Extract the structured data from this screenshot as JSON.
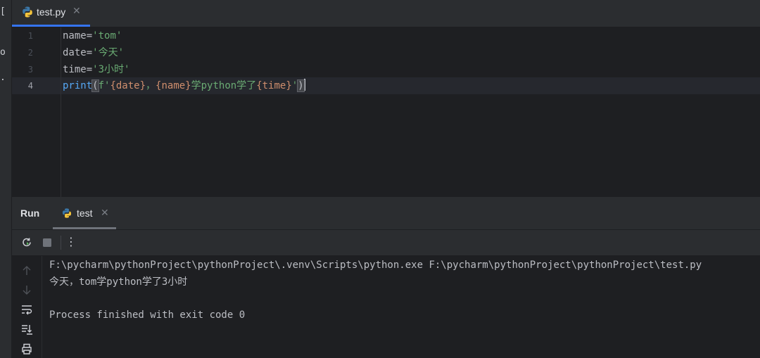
{
  "editor": {
    "tab": {
      "label": "test.py",
      "close": "✕"
    },
    "line_numbers": [
      "1",
      "2",
      "3",
      "4"
    ],
    "code": {
      "line1": {
        "var": "name",
        "eq": "=",
        "str": "'tom'"
      },
      "line2": {
        "var": "date",
        "eq": "=",
        "str": "'今天'"
      },
      "line3": {
        "var": "time",
        "eq": "=",
        "str": "'3小时'"
      },
      "line4": {
        "fn": "print",
        "open": "(",
        "prefix": "f'",
        "b1": "{date}",
        "sep": "，",
        "b2": "{name}",
        "mid": "学python学了",
        "b3": "{time}",
        "suffix": "'",
        "close": ")"
      }
    }
  },
  "run_panel": {
    "title": "Run",
    "tab": {
      "label": "test",
      "close": "✕"
    },
    "toolbar": {
      "more": "⋮"
    },
    "console": {
      "command": "F:\\pycharm\\pythonProject\\pythonProject\\.venv\\Scripts\\python.exe F:\\pycharm\\pythonProject\\pythonProject\\test.py",
      "output": "今天，tom学python学了3小时",
      "status": "Process finished with exit code 0"
    }
  },
  "left_strip": {
    "glyphs": [
      "[",
      "o",
      "."
    ]
  },
  "colors": {
    "background": "#1e1f22",
    "panel": "#2b2d30",
    "accent": "#3574f0",
    "string": "#6aab73",
    "function": "#56a8f5",
    "brace": "#cf8e6d"
  }
}
